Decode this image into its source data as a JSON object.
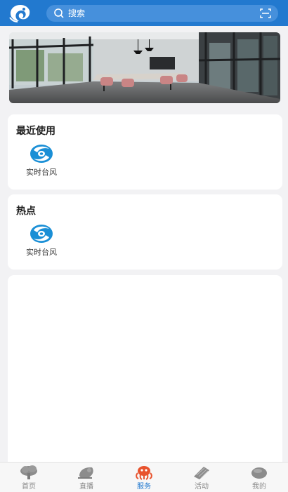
{
  "header": {
    "search_placeholder": "搜索"
  },
  "recent": {
    "title": "最近使用",
    "items": [
      {
        "label": "实时台风",
        "icon": "typhoon-icon"
      }
    ]
  },
  "hot": {
    "title": "热点",
    "items": [
      {
        "label": "实时台风",
        "icon": "typhoon-icon"
      }
    ]
  },
  "tabs": [
    {
      "label": "首页",
      "icon": "home-icon",
      "active": false
    },
    {
      "label": "直播",
      "icon": "live-icon",
      "active": false
    },
    {
      "label": "服务",
      "icon": "service-icon",
      "active": true
    },
    {
      "label": "活动",
      "icon": "activity-icon",
      "active": false
    },
    {
      "label": "我的",
      "icon": "profile-icon",
      "active": false
    }
  ],
  "colors": {
    "accent": "#2279cf",
    "typhoon": "#1a8fd6",
    "active_tab_icon": "#e8532e"
  }
}
